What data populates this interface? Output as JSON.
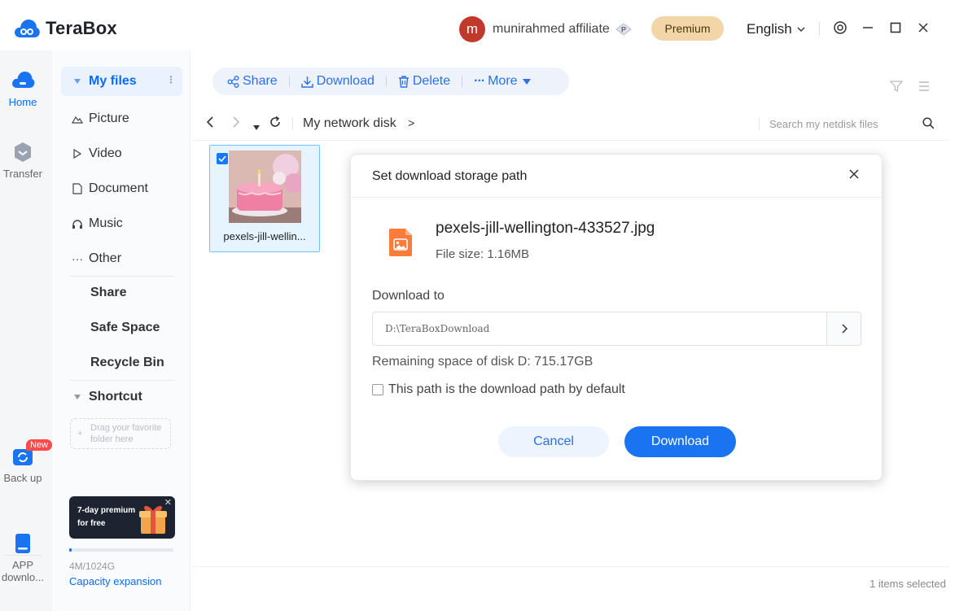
{
  "app": {
    "name": "TeraBox",
    "brand_color": "#0a6bff"
  },
  "header": {
    "avatar_initial": "m",
    "username": "munirahmed affiliate",
    "premium_label": "Premium",
    "language": "English"
  },
  "rail": {
    "home": "Home",
    "transfer": "Transfer",
    "backup": "Back up",
    "backup_badge": "New",
    "app_download": "APP downlo..."
  },
  "sidenav": {
    "my_files": "My files",
    "picture": "Picture",
    "video": "Video",
    "document": "Document",
    "music": "Music",
    "other": "Other",
    "share": "Share",
    "safe_space": "Safe Space",
    "recycle_bin": "Recycle Bin",
    "shortcut": "Shortcut",
    "drag_hint": "Drag your favorite folder here",
    "promo_line1": "7-day premium",
    "promo_line2": "for free",
    "capacity_used": "4M/1024G",
    "capacity_fraction": 0.01,
    "capacity_link": "Capacity expansion"
  },
  "toolbar": {
    "share": "Share",
    "download": "Download",
    "delete": "Delete",
    "more": "More"
  },
  "path": {
    "crumb": "My network disk",
    "crumb_sep": ">",
    "search_placeholder": "Search my netdisk files"
  },
  "files": [
    {
      "name": "pexels-jill-wellin...",
      "selected": true
    }
  ],
  "status": {
    "selected_text": "1 items selected"
  },
  "dialog": {
    "title": "Set download storage path",
    "file_name": "pexels-jill-wellington-433527.jpg",
    "file_size": "File size: 1.16MB",
    "download_to_label": "Download to",
    "path_value": "D:\\TeraBoxDownload",
    "remaining": "Remaining space of disk D: 715.17GB",
    "default_checkbox_label": "This path is the download path by default",
    "cancel_label": "Cancel",
    "download_label": "Download"
  }
}
